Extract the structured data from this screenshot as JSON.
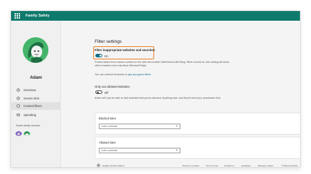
{
  "app": {
    "title": "Family Safety"
  },
  "sidebar": {
    "user_name": "Adam",
    "items": [
      {
        "label": "Overview",
        "icon": "overview-icon",
        "active": false
      },
      {
        "label": "Screen time",
        "icon": "screen-time-icon",
        "active": false
      },
      {
        "label": "Content filters",
        "icon": "content-filters-icon",
        "active": true
      },
      {
        "label": "Spending",
        "icon": "spending-icon",
        "active": false
      }
    ],
    "switch_label": "Switch family member"
  },
  "main": {
    "heading": "Filter settings",
    "filter_toggle": {
      "label": "Filter inappropriate websites and searches",
      "state_text": "On",
      "on": true
    },
    "filter_desc": "Protect Adam from mature content on the web and enable SafeSearch with Bing. When turned on, this setting will block other browsers and only allow Microsoft Edge.",
    "unblock_prefix": "You can unblock browsers in",
    "unblock_link": "app and game filters.",
    "allowed_only": {
      "label": "Only use allowed websites",
      "state_text": "Off",
      "on": false,
      "desc": "Adam will only be able to visit websites that you've allowed. Anything else, and they'll need your permission first."
    },
    "blocked": {
      "title": "Blocked sites",
      "placeholder": "Add a website"
    },
    "allowed": {
      "title": "Allowed sites",
      "placeholder": "Add a website"
    }
  },
  "footer": {
    "language": "English (United States)",
    "links": [
      "Privacy & cookies",
      "Terms of use",
      "Contact us",
      "Feedback",
      "Manage cookies"
    ],
    "copyright": "© Microsoft 2023"
  },
  "colors": {
    "brand": "#0e7a6c",
    "toggle_on": "#0f6e8c",
    "highlight": "#f07d1e",
    "avatar": "#44b56a"
  }
}
